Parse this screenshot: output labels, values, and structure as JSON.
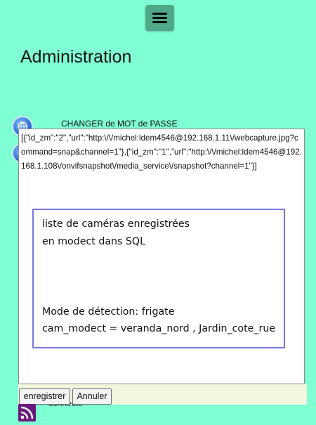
{
  "header": {
    "menu_icon": "hamburger-icon",
    "title": "Administration"
  },
  "menu": {
    "items": [
      {
        "label": "CHANGER de MOT de PASSE",
        "icon": "globe-icon"
      }
    ]
  },
  "editor": {
    "content": "[{\"id_zm\":\"2\",\"url\":\"http:\\/\\/michel:ldem4546@192.168.1.11\\/webcapture.jpg?command=snap&channel=1\"},{\"id_zm\":\"1\",\"url\":\"http:\\/\\/michel:ldem4546@192.168.1.108\\/onvifsnapshot\\/media_service\\/snapshot?channel=1\"}]"
  },
  "preview": {
    "line1": "liste de caméras enregistrées",
    "line2": "en modect dans SQL",
    "line3": "Mode de détection: frigate",
    "line4": "cam_modect = veranda_nord , Jardin_cote_rue"
  },
  "footer": {
    "save_label": "enregistrer",
    "cancel_label": "Annuler",
    "under_text": "connecté",
    "icon": "rss-icon"
  },
  "colors": {
    "background": "#80ffd4",
    "menu_button": "#4fa886",
    "preview_border": "#7777dd",
    "footer_strip": "#f2f6dc"
  }
}
